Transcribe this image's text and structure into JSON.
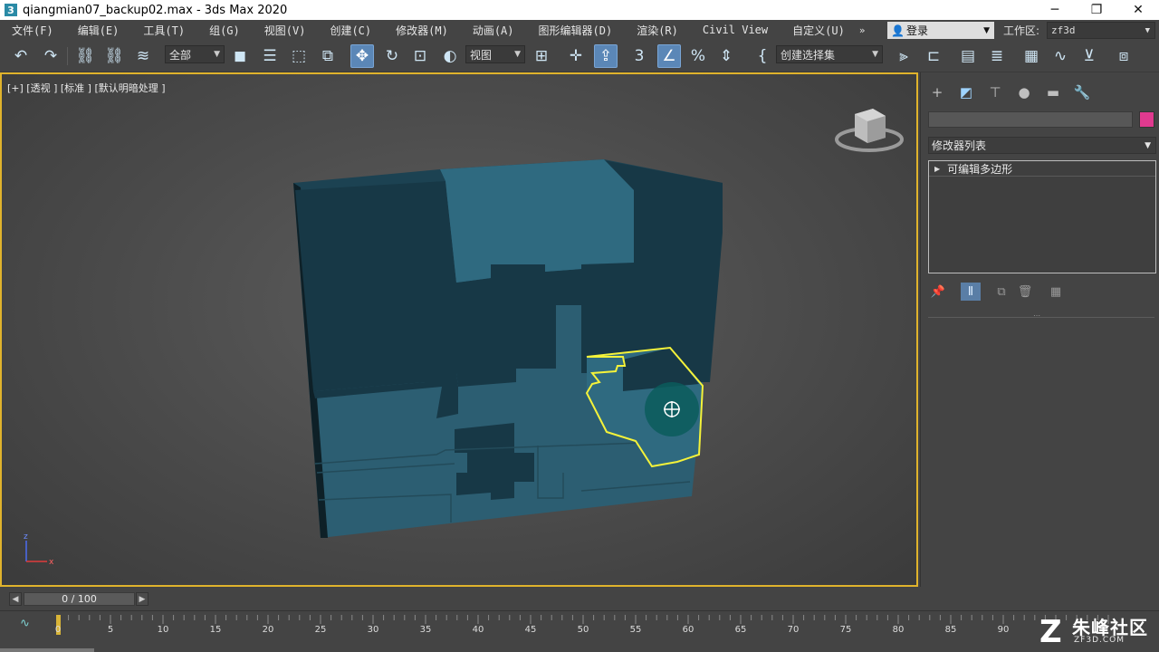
{
  "window": {
    "title": "qiangmian07_backup02.max - 3ds Max 2020",
    "app_icon": "3",
    "minimize": "─",
    "maximize": "❐",
    "close": "✕"
  },
  "menu": {
    "items": [
      "文件(F)",
      "编辑(E)",
      "工具(T)",
      "组(G)",
      "视图(V)",
      "创建(C)",
      "修改器(M)",
      "动画(A)",
      "图形编辑器(D)",
      "渲染(R)",
      "Civil View",
      "自定义(U)"
    ],
    "overflow": "»",
    "login": "登录",
    "workspace_label": "工作区:",
    "workspace_value": "zf3d"
  },
  "toolbar": {
    "selection_filter": "全部",
    "reference_coord": "视图",
    "named_selection": "创建选择集",
    "icons": [
      "undo-icon",
      "redo-icon",
      "link-icon",
      "unlink-icon",
      "bind-space-warp-icon",
      "select-object-icon",
      "select-by-name-icon",
      "rect-selection-icon",
      "window-crossing-icon",
      "select-move-icon",
      "select-rotate-icon",
      "select-scale-icon",
      "select-place-icon",
      "use-pivot-icon",
      "snaps-toggle-icon",
      "angle-snap-icon",
      "percent-snap-icon",
      "spinner-snap-icon",
      "edit-named-selection-icon",
      "mirror-icon",
      "align-icon",
      "scene-explorer-icon",
      "layer-explorer-icon",
      "toggle-ribbon-icon",
      "curve-editor-icon",
      "schematic-view-icon",
      "material-editor-icon"
    ]
  },
  "viewport": {
    "label": "[+] [透视 ] [标准 ] [默认明暗处理 ]",
    "object_color": "#2c5e72",
    "dark_color": "#173846",
    "selection_color": "#f4f23a",
    "axis_labels": {
      "z": "z",
      "x": "x"
    }
  },
  "command_panel": {
    "modifier_list": "修改器列表",
    "stack": [
      "可编辑多边形"
    ],
    "object_color": "#e03a8f",
    "tabs": [
      "create-tab-icon",
      "modify-tab-icon",
      "hierarchy-tab-icon",
      "motion-tab-icon",
      "display-tab-icon",
      "utilities-tab-icon"
    ]
  },
  "timeline": {
    "frame_display": "0 / 100",
    "current_frame": 0,
    "start": 0,
    "end": 100,
    "tick_labels": [
      "0",
      "5",
      "10",
      "15",
      "20",
      "25",
      "30",
      "35",
      "40",
      "45",
      "50",
      "55",
      "60",
      "65",
      "70",
      "75",
      "80",
      "85",
      "90"
    ]
  },
  "watermark": {
    "main": "朱峰社区",
    "sub": "ZF3D.COM",
    "logo": "Z"
  }
}
